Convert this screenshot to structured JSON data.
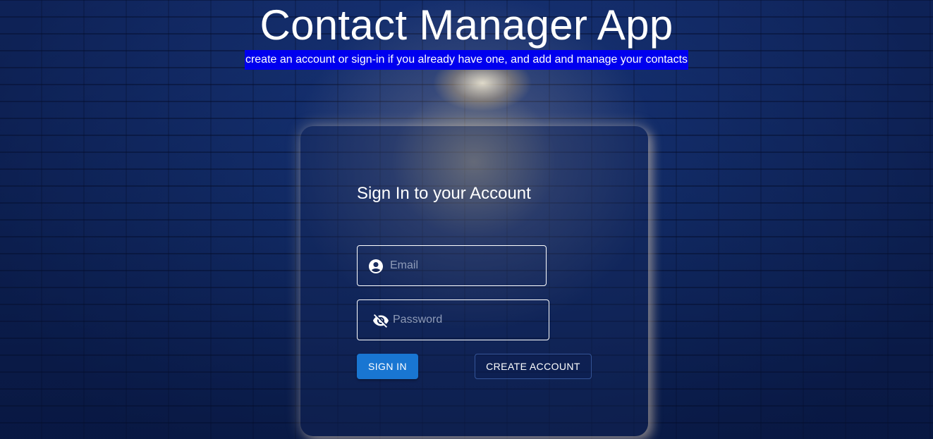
{
  "header": {
    "title": "Contact Manager App",
    "subtitle": "create an account or sign-in if you already have one, and add and manage your contacts"
  },
  "signin_form": {
    "title": "Sign In to your Account",
    "email": {
      "value": "",
      "placeholder": "Email",
      "icon": "account-circle-icon"
    },
    "password": {
      "value": "",
      "placeholder": "Password",
      "icon": "eye-off-icon"
    },
    "sign_in_label": "SIGN IN",
    "create_account_label": "CREATE ACCOUNT"
  },
  "colors": {
    "subtitle_highlight": "#0000ee",
    "primary_button": "#1976d2",
    "background": "#14306f"
  }
}
